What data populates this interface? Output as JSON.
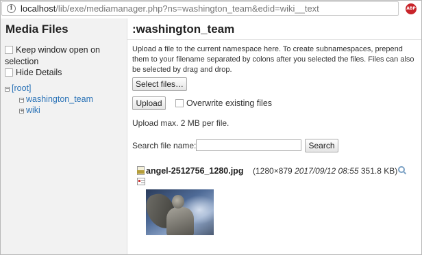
{
  "browser": {
    "url_host": "localhost",
    "url_path": "/lib/exe/mediamanager.php?ns=washington_team&edid=wiki__text",
    "adblock_label": "ABP"
  },
  "sidebar": {
    "title": "Media Files",
    "options": [
      {
        "label": "Keep window open on selection",
        "checked": false
      },
      {
        "label": "Hide Details",
        "checked": false
      }
    ],
    "tree": {
      "root": {
        "label": "[root]",
        "toggle": "−"
      },
      "children": [
        {
          "label": "washington_team",
          "toggle": "−"
        },
        {
          "label": "wiki",
          "toggle": "+"
        }
      ]
    }
  },
  "main": {
    "namespace_title": ":washington_team",
    "upload_description": "Upload a file to the current namespace here. To create subnamespaces, prepend them to your filename separated by colons after you selected the files. Files can also be selected by drag and drop.",
    "select_files_label": "Select files…",
    "upload_label": "Upload",
    "overwrite_label": "Overwrite existing files",
    "overwrite_checked": false,
    "max_size_note": "Upload max. 2 MB per file.",
    "search_label": "Search file name:",
    "search_value": "",
    "search_button": "Search",
    "file": {
      "name": "angel-2512756_1280.jpg",
      "dimensions": "(1280×879",
      "date": "2017/09/12 08:55",
      "size": "351.8 KB)"
    }
  }
}
